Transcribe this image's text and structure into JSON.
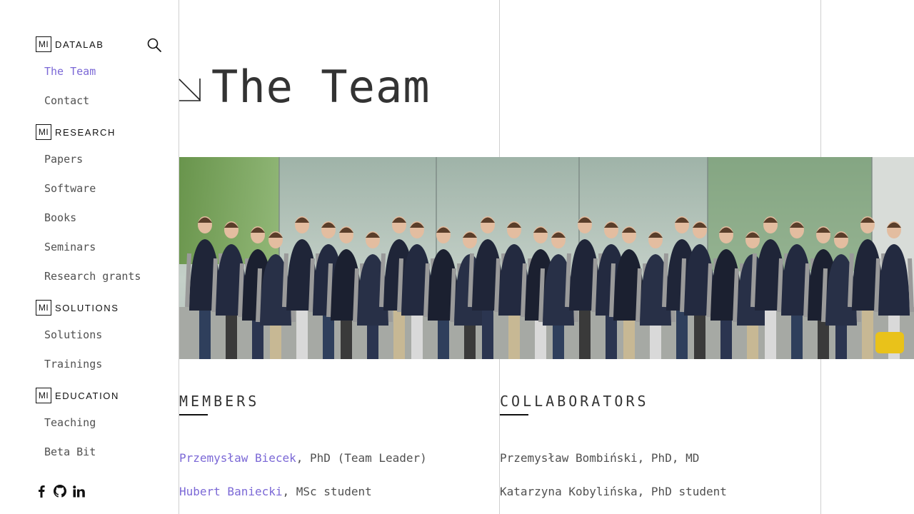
{
  "sidebar": {
    "sections": [
      {
        "brand_mark": "MI",
        "brand_name": "DATALAB",
        "items": [
          {
            "label": "The Team",
            "active": true
          },
          {
            "label": "Contact"
          }
        ]
      },
      {
        "brand_mark": "MI",
        "brand_name": "RESEARCH",
        "items": [
          {
            "label": "Papers"
          },
          {
            "label": "Software"
          },
          {
            "label": "Books"
          },
          {
            "label": "Seminars"
          },
          {
            "label": "Research grants"
          }
        ]
      },
      {
        "brand_mark": "MI",
        "brand_name": "SOLUTIONS",
        "items": [
          {
            "label": "Solutions"
          },
          {
            "label": "Trainings"
          }
        ]
      },
      {
        "brand_mark": "MI",
        "brand_name": "EDUCATION",
        "items": [
          {
            "label": "Teaching"
          },
          {
            "label": "Beta Bit"
          }
        ]
      }
    ],
    "search_icon": "search-icon",
    "social_icons": [
      "facebook-icon",
      "github-icon",
      "linkedin-icon"
    ]
  },
  "page": {
    "title": "The Team",
    "title_icon": "arrow-down-right-icon"
  },
  "photo": {
    "subject": "team-photo"
  },
  "members": {
    "heading": "MEMBERS",
    "people": [
      {
        "name": "Przemysław Biecek",
        "suffix": ", PhD (Team Leader)"
      },
      {
        "name": "Hubert Baniecki",
        "suffix": ", MSc student"
      }
    ]
  },
  "collaborators": {
    "heading": "COLLABORATORS",
    "people": [
      {
        "text": "Przemysław Bombiński, PhD, MD"
      },
      {
        "text": "Katarzyna Kobylińska, PhD student"
      }
    ]
  },
  "colors": {
    "accent": "#7b68d6",
    "text": "#505050",
    "divider": "#cfcfcf"
  }
}
